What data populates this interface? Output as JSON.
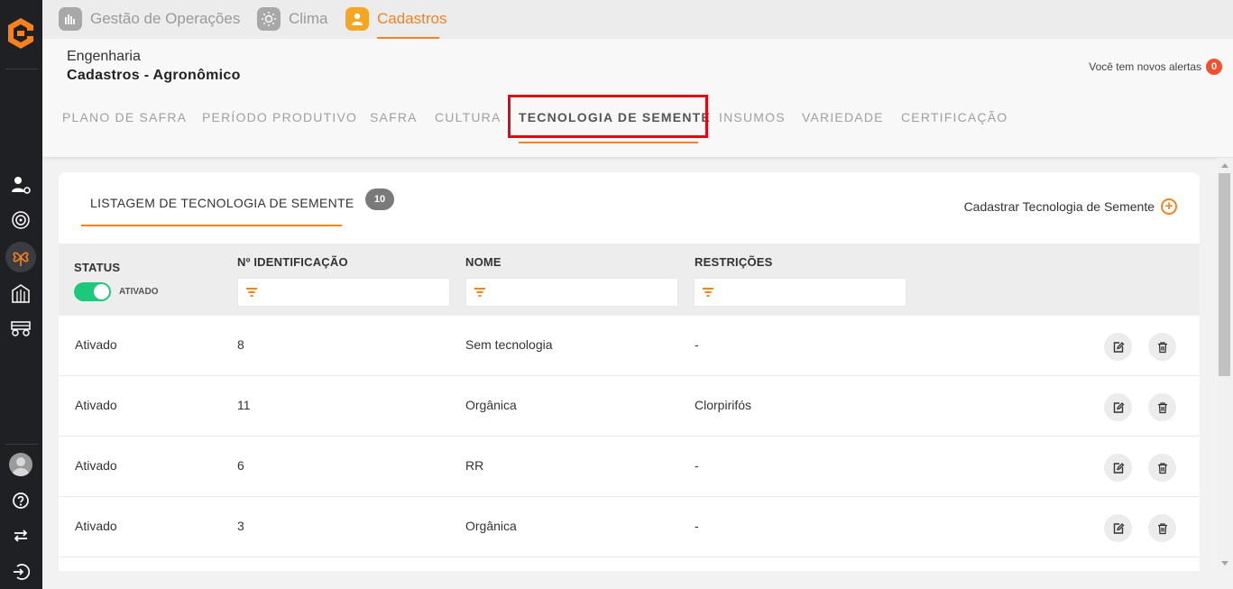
{
  "modules": [
    {
      "label": "Gestão de Operações",
      "icon": "operations-icon",
      "active": false
    },
    {
      "label": "Clima",
      "icon": "weather-icon",
      "active": false
    },
    {
      "label": "Cadastros",
      "icon": "user-icon",
      "active": true
    }
  ],
  "header": {
    "breadcrumb_top": "Engenharia",
    "breadcrumb_bottom": "Cadastros - Agronômico",
    "alerts_label": "Você tem novos alertas",
    "alerts_count": "0"
  },
  "tabs": [
    {
      "label": "PLANO DE SAFRA"
    },
    {
      "label": "PERÍODO PRODUTIVO"
    },
    {
      "label": "SAFRA"
    },
    {
      "label": "CULTURA"
    },
    {
      "label": "TECNOLOGIA DE SEMENTE",
      "active": true
    },
    {
      "label": "INSUMOS"
    },
    {
      "label": "VARIEDADE"
    },
    {
      "label": "CERTIFICAÇÃO"
    }
  ],
  "listing": {
    "title": "LISTAGEM DE TECNOLOGIA DE SEMENTE",
    "count": "10",
    "add_label": "Cadastrar Tecnologia de Semente"
  },
  "columns": {
    "status": "STATUS",
    "status_toggle": "ATIVADO",
    "identificacao": "Nº IDENTIFICAÇÃO",
    "nome": "NOME",
    "restricoes": "RESTRIÇÕES"
  },
  "rows": [
    {
      "status": "Ativado",
      "id": "8",
      "nome": "Sem tecnologia",
      "restricoes": "-"
    },
    {
      "status": "Ativado",
      "id": "11",
      "nome": "Orgânica",
      "restricoes": "Clorpirifós"
    },
    {
      "status": "Ativado",
      "id": "6",
      "nome": "RR",
      "restricoes": "-"
    },
    {
      "status": "Ativado",
      "id": "3",
      "nome": "Orgânica",
      "restricoes": "-"
    }
  ],
  "colors": {
    "accent": "#f5821f",
    "highlight": "#e30613",
    "toggle_on": "#1ec87a"
  }
}
